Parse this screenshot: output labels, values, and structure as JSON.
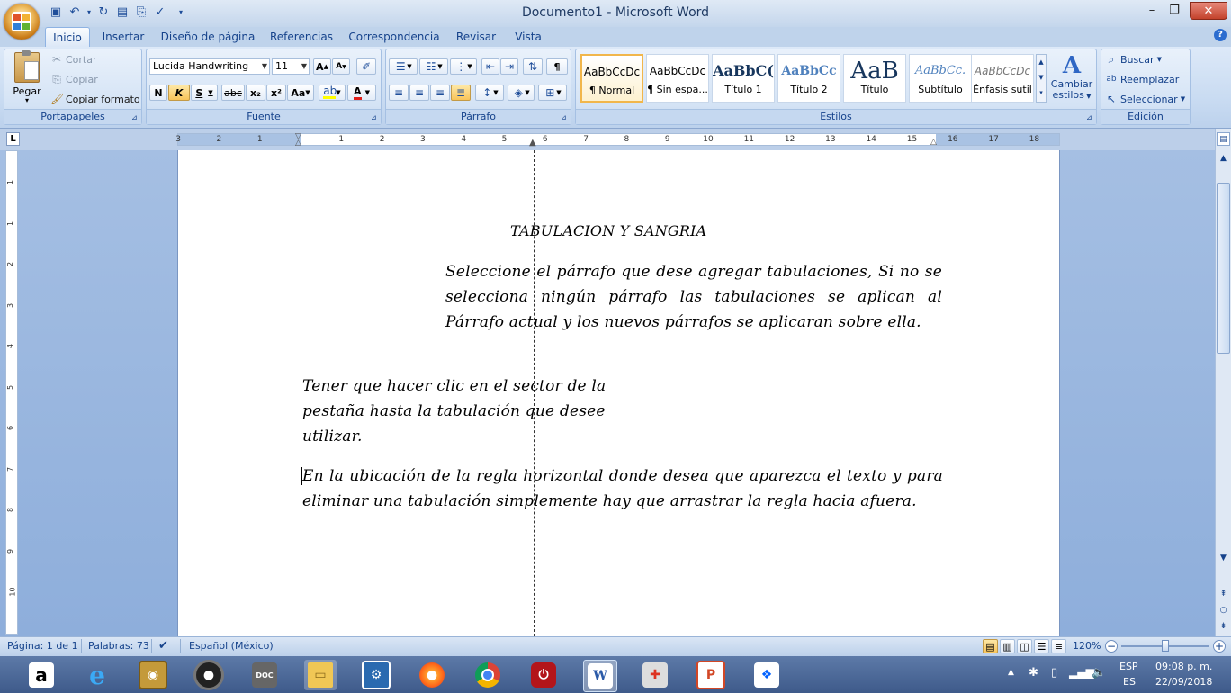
{
  "window": {
    "title": "Documento1 - Microsoft Word",
    "minimize_label": "–",
    "restore_label": "❐",
    "close_label": "✕"
  },
  "quick_access": {
    "save_icon": "save-icon",
    "undo_icon": "undo-icon",
    "redo_icon": "redo-icon",
    "spelling_icon": "spelling-icon"
  },
  "tabs": [
    "Inicio",
    "Insertar",
    "Diseño de página",
    "Referencias",
    "Correspondencia",
    "Revisar",
    "Vista"
  ],
  "ribbon": {
    "clipboard": {
      "label": "Portapapeles",
      "paste": "Pegar",
      "cut": "Cortar",
      "copy": "Copiar",
      "format_painter": "Copiar formato"
    },
    "font": {
      "label": "Fuente",
      "font_name": "Lucida Handwriting",
      "font_size": "11",
      "grow": "A",
      "shrink": "A",
      "bold": "N",
      "italic": "K",
      "underline": "S",
      "strike": "abc",
      "subscript": "x₂",
      "superscript": "x²",
      "change_case": "Aa",
      "font_color": "A"
    },
    "paragraph": {
      "label": "Párrafo",
      "show_marks": "¶"
    },
    "styles": {
      "label": "Estilos",
      "items": [
        {
          "sample": "AaBbCcDc",
          "name": "¶ Normal"
        },
        {
          "sample": "AaBbCcDc",
          "name": "¶ Sin espa..."
        },
        {
          "sample": "AaBbC(",
          "name": "Título 1"
        },
        {
          "sample": "AaBbCc",
          "name": "Título 2"
        },
        {
          "sample": "AaB",
          "name": "Título"
        },
        {
          "sample": "AaBbCc.",
          "name": "Subtítulo"
        },
        {
          "sample": "AaBbCcDc",
          "name": "Énfasis sutil"
        }
      ],
      "change_styles": "Cambiar",
      "change_styles_2": "estilos"
    },
    "editing": {
      "label": "Edición",
      "find": "Buscar",
      "replace": "Reemplazar",
      "select": "Seleccionar"
    }
  },
  "ruler": {
    "left_numbers": [
      "3",
      "2",
      "1"
    ],
    "right_numbers": [
      "1",
      "2",
      "3",
      "4",
      "5",
      "6",
      "7",
      "8",
      "9",
      "10",
      "11",
      "12",
      "13",
      "14",
      "15",
      "16",
      "17",
      "18"
    ],
    "vertical_numbers": [
      "1",
      "1",
      "2",
      "3",
      "4",
      "5",
      "6",
      "7",
      "8",
      "9",
      "10"
    ]
  },
  "document": {
    "title": "TABULACION Y SANGRIA",
    "p1": "Seleccione el párrafo que dese agregar tabulaciones, Si no se selecciona ningún párrafo las tabulaciones se aplican al Párrafo actual y los nuevos párrafos se aplicaran sobre ella.",
    "p2": "Tener que hacer clic en el sector de la pestaña hasta la tabulación que desee utilizar.",
    "p3": "En la ubicación de la regla horizontal donde desea que aparezca el texto y para eliminar una tabulación simplemente hay que arrastrar la regla hacia afuera."
  },
  "status": {
    "page": "Página: 1 de 1",
    "words": "Palabras: 73",
    "language": "Español (México)",
    "zoom": "120%",
    "zoom_minus": "−",
    "zoom_plus": "+"
  },
  "taskbar": {
    "apps": [
      "amazon-icon",
      "edge-icon",
      "media-icon",
      "speaker-icon",
      "doc-icon",
      "folder-icon",
      "settings-icon",
      "firefox-icon",
      "chrome-icon",
      "power-icon",
      "word-icon",
      "files-icon",
      "powerpoint-icon",
      "dropbox-icon"
    ],
    "lang_top": "ESP",
    "lang_bottom": "ES",
    "time": "09:08 p. m.",
    "date": "22/09/2018"
  },
  "colors": {
    "accent": "#15428b",
    "taskbar": "#4a6797",
    "ribbon": "#d4e3f5"
  }
}
